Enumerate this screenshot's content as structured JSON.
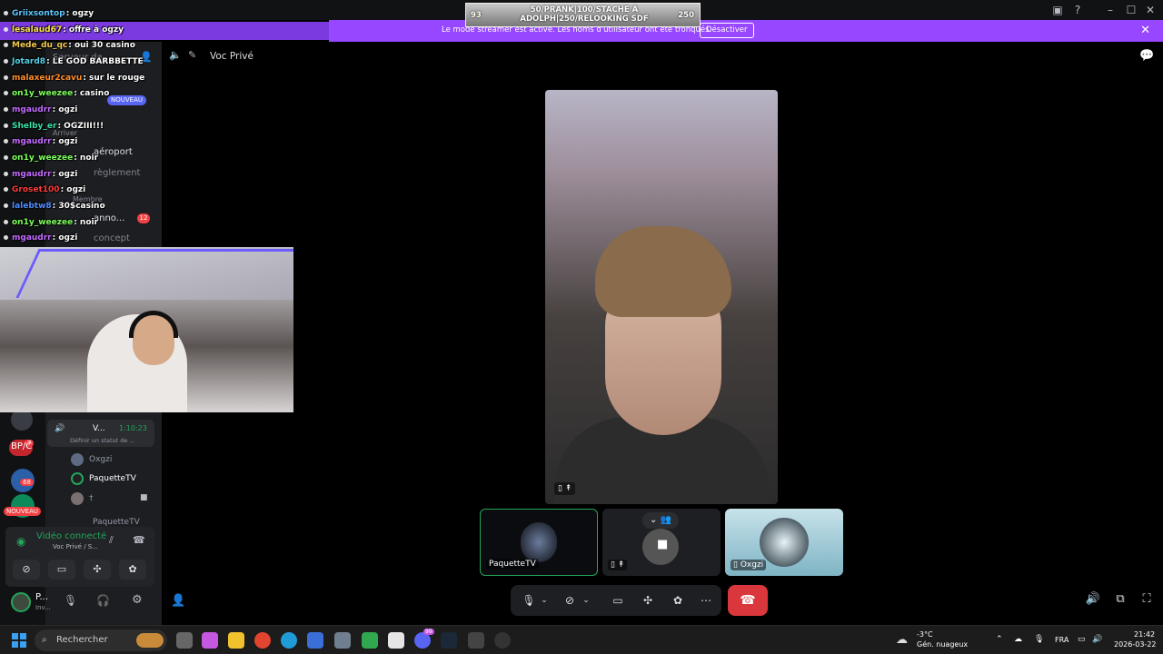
{
  "banner": {
    "text": "Le mode streamer est activé. Les noms d'utilisateur ont été tronqués.",
    "button": "Désactiver",
    "close": "✕"
  },
  "donation": {
    "left_value": "93",
    "right_value": "250",
    "line1": "50/PRANK|100/STACHE À",
    "line2": "ADOLPH|250/RELOOKING SDF"
  },
  "chat": [
    {
      "user": "Griixsontop",
      "msg": ": ogzy",
      "color": "#5ec8ff"
    },
    {
      "user": "lesalaud67",
      "msg": ": offre à ogzy",
      "color": "#ffe34d"
    },
    {
      "user": "Mede_du_qc",
      "msg": ": oui 30 casino",
      "color": "#f3c94b"
    },
    {
      "user": "Jotard8",
      "msg": ": LE GOD BARBBETTE",
      "color": "#55d1e6"
    },
    {
      "user": "malaxeur2cavu",
      "msg": ": sur le rouge",
      "color": "#ff8e2b"
    },
    {
      "user": "on1y_weezee",
      "msg": ": casino",
      "color": "#7cff5a"
    },
    {
      "user": "mgaudrr",
      "msg": ": ogzi",
      "color": "#c46bff"
    },
    {
      "user": "Shelby_er",
      "msg": ": OGZIII!!!",
      "color": "#37e3a7"
    },
    {
      "user": "mgaudrr",
      "msg": ": ogzi",
      "color": "#c46bff"
    },
    {
      "user": "on1y_weezee",
      "msg": ": noir",
      "color": "#7cff5a"
    },
    {
      "user": "mgaudrr",
      "msg": ": ogzi",
      "color": "#c46bff"
    },
    {
      "user": "Groset100",
      "msg": ": ogzi",
      "color": "#ff3b3b"
    },
    {
      "user": "lalebtw8",
      "msg": ": 30$casino",
      "color": "#4f8bff"
    },
    {
      "user": "on1y_weezee",
      "msg": ": noir",
      "color": "#7cff5a"
    },
    {
      "user": "mgaudrr",
      "msg": ": ogzi",
      "color": "#c46bff"
    }
  ],
  "channels": {
    "server_label": "Serveur de",
    "items": [
      "aéroport",
      "règlement",
      "anno...",
      "concept"
    ],
    "category_arriver": "Arriver",
    "category_membre": "Membre",
    "new_badge": "NOUVEAU",
    "unread_count": "12"
  },
  "rail": {
    "bpc_label": "BP/C",
    "badge_68": "68",
    "badge_7": "7",
    "new_label": "NOUVEAU"
  },
  "voice_panel": {
    "channel": "V...",
    "timer": "1:10:23",
    "status_placeholder": "Définir un statut de ...",
    "members": [
      "Oxgzi",
      "PaquetteTV",
      "†",
      "PaquetteTV"
    ]
  },
  "connection": {
    "title": "Vidéo connecté",
    "subtitle": "Voc Privé / S..."
  },
  "user": {
    "name": "P...",
    "status": "Inv..."
  },
  "header": {
    "channel": "Voc Privé"
  },
  "tiles": [
    {
      "label": "PaquetteTV"
    },
    {
      "label": ""
    },
    {
      "label": "Oxgzi"
    }
  ],
  "taskbar": {
    "search": "Rechercher",
    "weather_temp": "-3°C",
    "weather_desc": "Gén. nuageux",
    "lang": "FRA",
    "time": "21:42",
    "date": "2026-03-22",
    "discord_badge": "99"
  }
}
